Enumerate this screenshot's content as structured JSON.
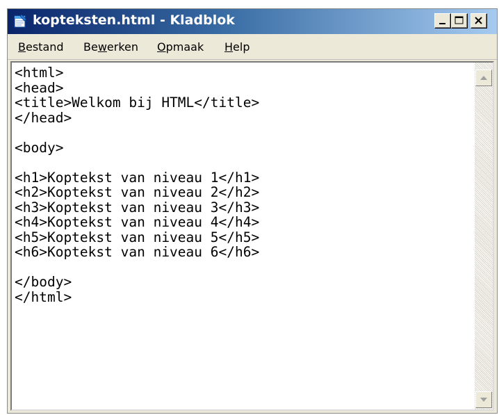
{
  "window": {
    "title": "kopteksten.html - Kladblok",
    "icon": "notepad-icon"
  },
  "controls": {
    "minimize_icon": "minimize-icon",
    "maximize_icon": "maximize-icon",
    "close_icon": "close-icon"
  },
  "menu": {
    "items": [
      {
        "label": "Bestand",
        "mnemonic": "B"
      },
      {
        "label": "Bewerken",
        "mnemonic": "w"
      },
      {
        "label": "Opmaak",
        "mnemonic": "O"
      },
      {
        "label": "Help",
        "mnemonic": "H"
      }
    ]
  },
  "editor": {
    "content": "<html>\n<head>\n<title>Welkom bij HTML</title>\n</head>\n\n<body>\n\n<h1>Koptekst van niveau 1</h1>\n<h2>Koptekst van niveau 2</h2>\n<h3>Koptekst van niveau 3</h3>\n<h4>Koptekst van niveau 4</h4>\n<h5>Koptekst van niveau 5</h5>\n<h6>Koptekst van niveau 6</h6>\n\n</body>\n</html>"
  },
  "colors": {
    "titlebar_start": "#0a246a",
    "titlebar_end": "#a6caf0",
    "chrome": "#ece9d8"
  }
}
